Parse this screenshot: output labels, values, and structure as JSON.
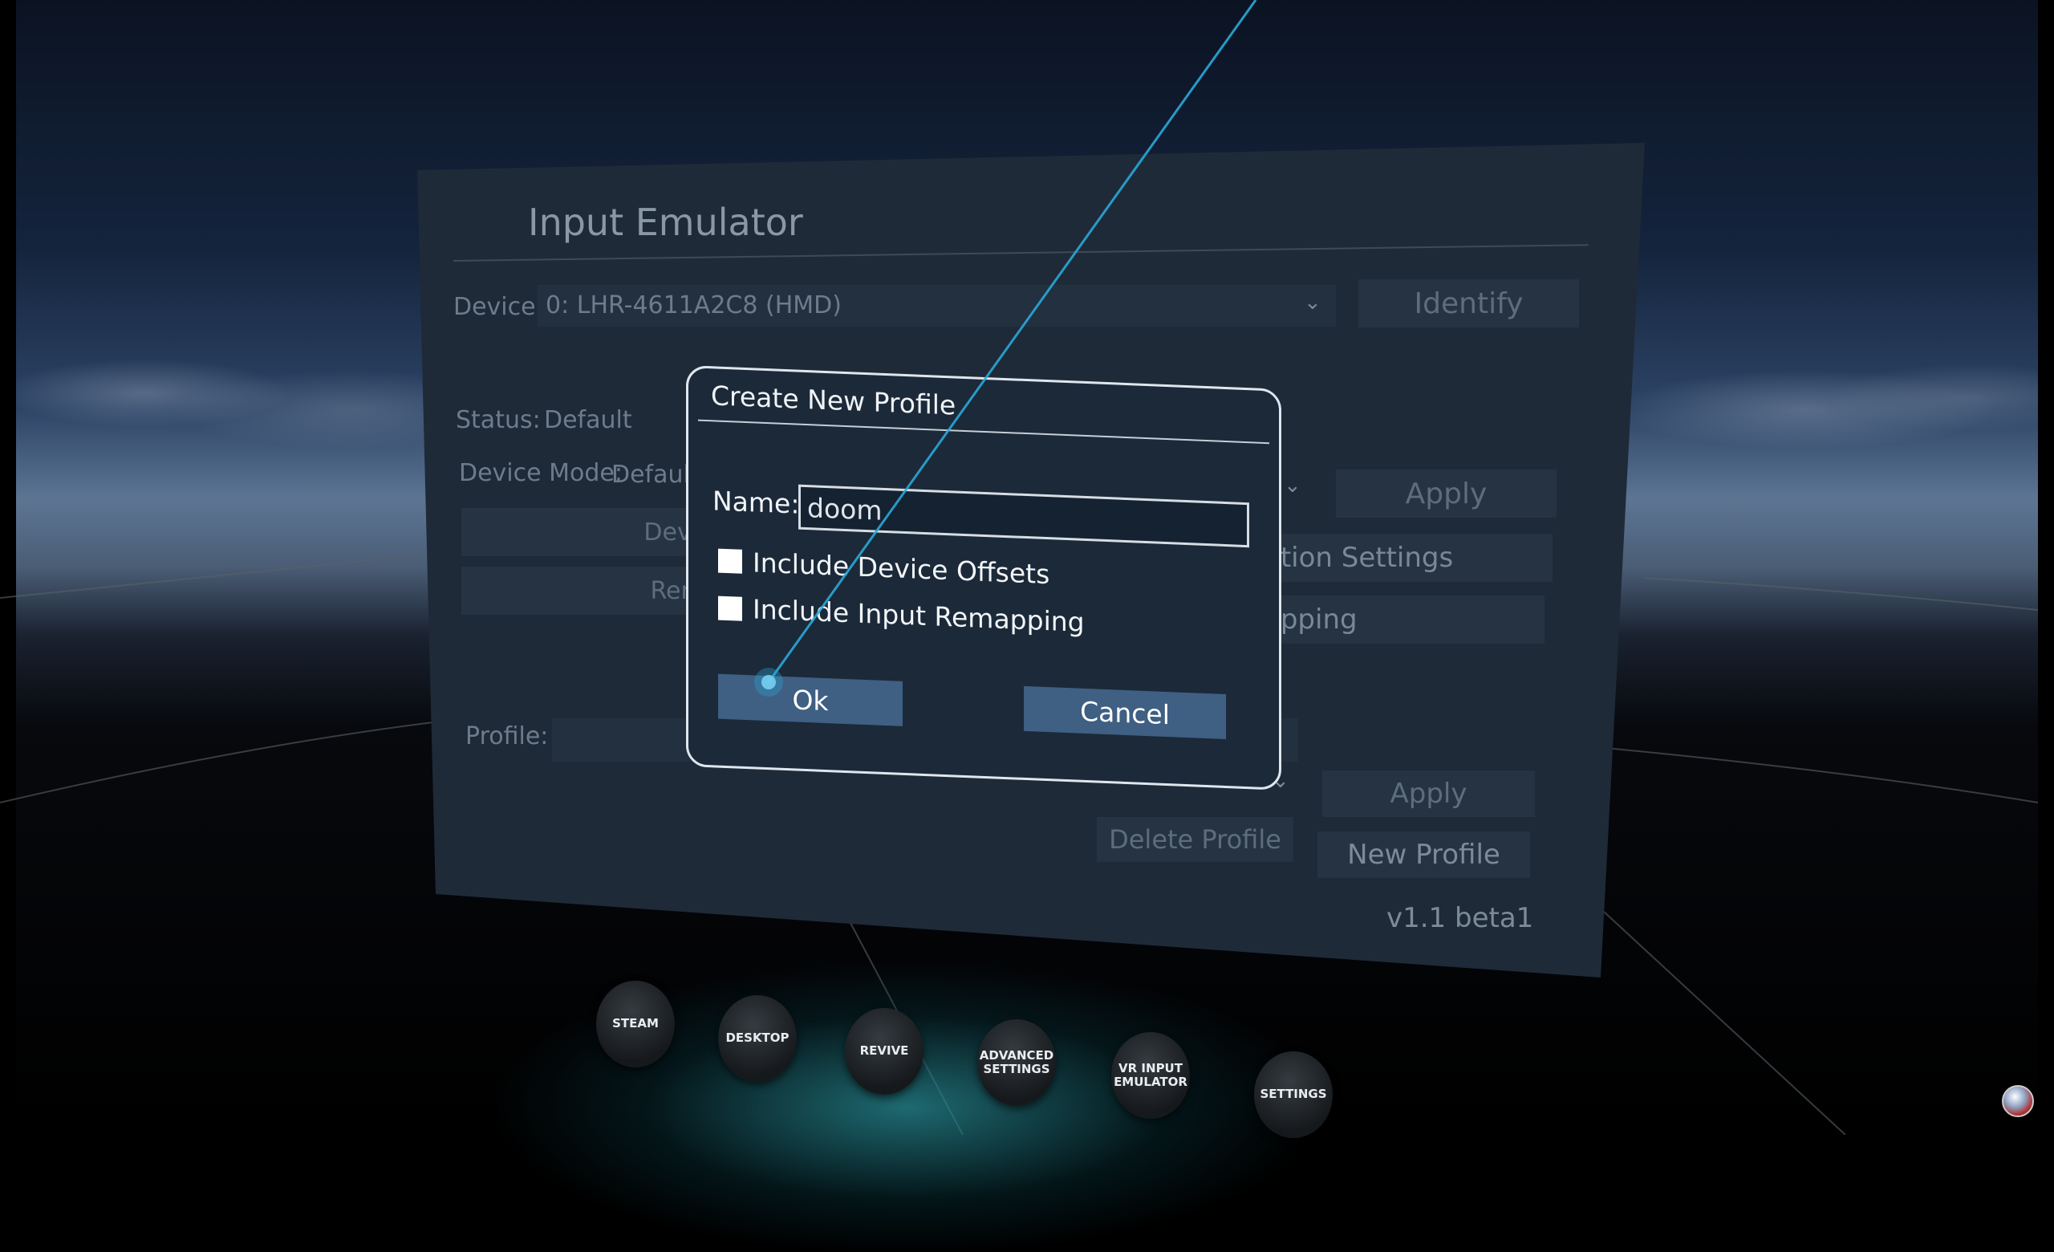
{
  "panel": {
    "title": "Input Emulator",
    "device_label": "Device:",
    "device_value": "0: LHR-4611A2C8 (HMD)",
    "identify_button": "Identify",
    "status_label": "Status:",
    "status_value": "Default",
    "device_mode_label": "Device Mode:",
    "device_mode_value": "Default",
    "apply_button_1": "Apply",
    "device_btn_partial": "Device",
    "render_btn_partial": "Rende",
    "calibration_settings_partial": "ation Settings",
    "remapping_partial": "apping",
    "profile_label": "Profile:",
    "apply_button_2": "Apply",
    "delete_profile_button": "Delete Profile",
    "new_profile_button": "New Profile",
    "version": "v1.1 beta1"
  },
  "dialog": {
    "title": "Create New Profile",
    "name_label": "Name:",
    "name_value": "doom",
    "include_device_offsets": "Include Device Offsets",
    "include_device_offsets_checked": false,
    "include_input_remapping": "Include Input Remapping",
    "include_input_remapping_checked": false,
    "ok_button": "Ok",
    "cancel_button": "Cancel"
  },
  "dock": {
    "steam": "STEAM",
    "desktop": "DESKTOP",
    "revive": "REVIVE",
    "advanced_settings": "ADVANCED SETTINGS",
    "vr_input_emulator": "VR INPUT EMULATOR",
    "settings": "SETTINGS"
  },
  "colors": {
    "dialog_button": "#3f5f83",
    "laser": "#2aa8d8",
    "panel_bg": "#1e2a38"
  }
}
